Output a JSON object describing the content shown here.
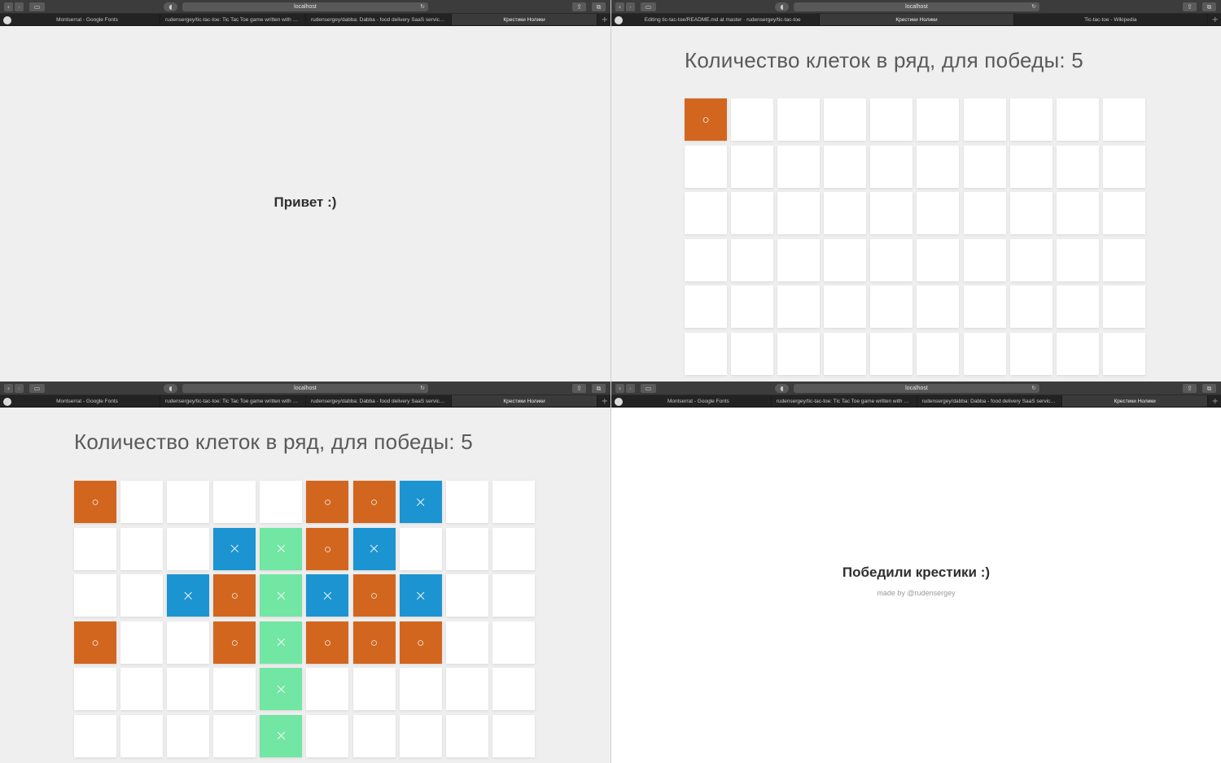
{
  "colors": {
    "o": "#d2661f",
    "x": "#1c94d2",
    "winning_x": "#72e6a3"
  },
  "browser": {
    "url": "localhost",
    "tabs_a": [
      {
        "label": "Montserrat - Google Fonts"
      },
      {
        "label": "rudensergey/tic-tac-toe: Tic Tac Toe game written with Red..."
      },
      {
        "label": "rudensergey/dabba: Dabba - food delivery SaaS service for..."
      },
      {
        "label": "Крестики Нолики",
        "active": true
      }
    ],
    "tabs_b": [
      {
        "label": "Editing tic-tac-toe/README.md at master · rudensergey/tic-tac-toe"
      },
      {
        "label": "Крестики Нолики",
        "active": true
      },
      {
        "label": "Tic-tac-toe - Wikipedia"
      }
    ]
  },
  "screen_welcome": {
    "greeting": "Привет :)"
  },
  "screen_game_start": {
    "title": "Количество клеток в ряд, для победы: 5",
    "rows": [
      [
        "O",
        "",
        "",
        "",
        "",
        "",
        "",
        "",
        "",
        ""
      ],
      [
        "",
        "",
        "",
        "",
        "",
        "",
        "",
        "",
        "",
        ""
      ],
      [
        "",
        "",
        "",
        "",
        "",
        "",
        "",
        "",
        "",
        ""
      ],
      [
        "",
        "",
        "",
        "",
        "",
        "",
        "",
        "",
        "",
        ""
      ],
      [
        "",
        "",
        "",
        "",
        "",
        "",
        "",
        "",
        "",
        ""
      ],
      [
        "",
        "",
        "",
        "",
        "",
        "",
        "",
        "",
        "",
        ""
      ]
    ]
  },
  "screen_game_end": {
    "title": "Количество клеток в ряд, для победы: 5",
    "rows": [
      [
        "O",
        "",
        "",
        "",
        "",
        "O",
        "O",
        "X",
        "",
        ""
      ],
      [
        "",
        "",
        "",
        "X",
        "X*",
        "O",
        "X",
        "",
        "",
        ""
      ],
      [
        "",
        "",
        "X",
        "O",
        "X*",
        "X",
        "O",
        "X",
        "",
        ""
      ],
      [
        "O",
        "",
        "",
        "O",
        "X*",
        "O",
        "O",
        "O",
        "",
        ""
      ],
      [
        "",
        "",
        "",
        "",
        "X*",
        "",
        "",
        "",
        "",
        ""
      ],
      [
        "",
        "",
        "",
        "",
        "X*",
        "",
        "",
        "",
        "",
        ""
      ]
    ]
  },
  "screen_result": {
    "message": "Победили крестики :)",
    "credit": "made by @rudensergey"
  }
}
